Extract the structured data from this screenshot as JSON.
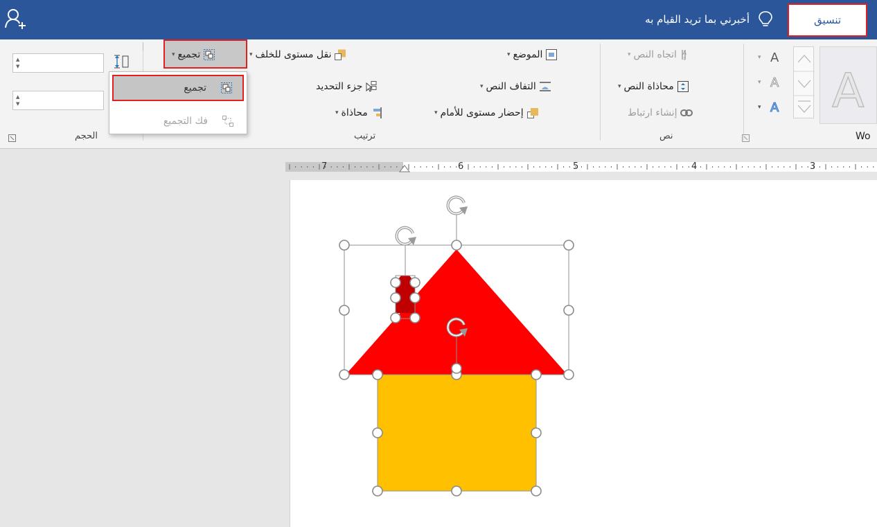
{
  "topbar": {
    "tell_me": "أخبرني بما تريد القيام به",
    "active_tab": "تنسيق",
    "bg_color": "#2b579a"
  },
  "ribbon": {
    "text_group": {
      "label": "نص",
      "text_direction": "اتجاه النص",
      "align_text": "محاذاة النص",
      "create_link": "إنشاء ارتباط"
    },
    "arrange_group": {
      "label": "ترتيب",
      "position": "الموضع",
      "wrap_text": "التفاف النص",
      "bring_forward": "إحضار مستوى للأمام",
      "send_backward": "نقل مستوى للخلف",
      "selection_pane": "جزء التحديد",
      "align": "محاذاة",
      "group": "تجميع"
    },
    "size_group": {
      "label": "الحجم"
    },
    "wordart_label": "Wo"
  },
  "group_menu": {
    "group": "تجميع",
    "ungroup": "فك التجميع"
  },
  "ruler": {
    "numbers": [
      "7",
      "6",
      "5",
      "4",
      "3"
    ]
  },
  "shapes": {
    "roof_color": "#ff0000",
    "body_color": "#ffc000",
    "chimney_color": "#c00000"
  }
}
